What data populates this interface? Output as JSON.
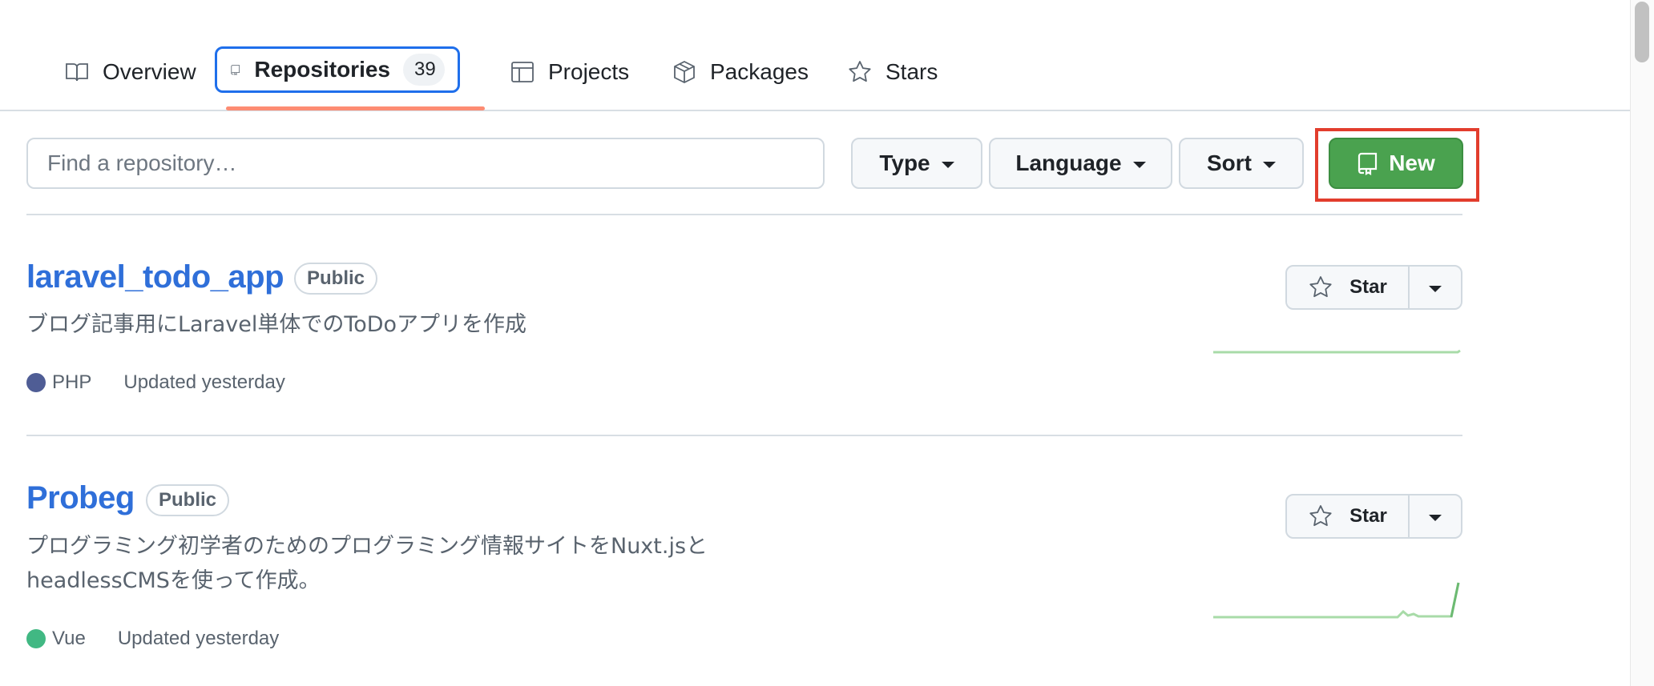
{
  "tabs": [
    {
      "label": "Overview",
      "icon": "book-icon"
    },
    {
      "label": "Repositories",
      "icon": "repo-icon",
      "count": "39",
      "selected": true
    },
    {
      "label": "Projects",
      "icon": "table-icon"
    },
    {
      "label": "Packages",
      "icon": "package-icon"
    },
    {
      "label": "Stars",
      "icon": "star-icon"
    }
  ],
  "filters": {
    "search_placeholder": "Find a repository…",
    "type_label": "Type",
    "language_label": "Language",
    "sort_label": "Sort",
    "new_label": "New"
  },
  "repos": [
    {
      "name": "laravel_todo_app",
      "visibility": "Public",
      "description": "ブログ記事用にLaravel単体でのToDoアプリを作成",
      "language": "PHP",
      "language_color": "#4F5D95",
      "updated": "Updated yesterday",
      "star_label": "Star"
    },
    {
      "name": "Probeg",
      "visibility": "Public",
      "description_line1": "プログラミング初学者のためのプログラミング情報サイトをNuxt.jsと",
      "description_line2": "headlessCMSを使って作成。",
      "language": "Vue",
      "language_color": "#41b883",
      "updated": "Updated yesterday",
      "star_label": "Star"
    }
  ],
  "colors": {
    "accent": "#1f6feb",
    "link": "#2f6fd9",
    "new_button": "#4aa24f",
    "highlight": "#e23d2d",
    "tab_underline": "#fd8c73"
  }
}
